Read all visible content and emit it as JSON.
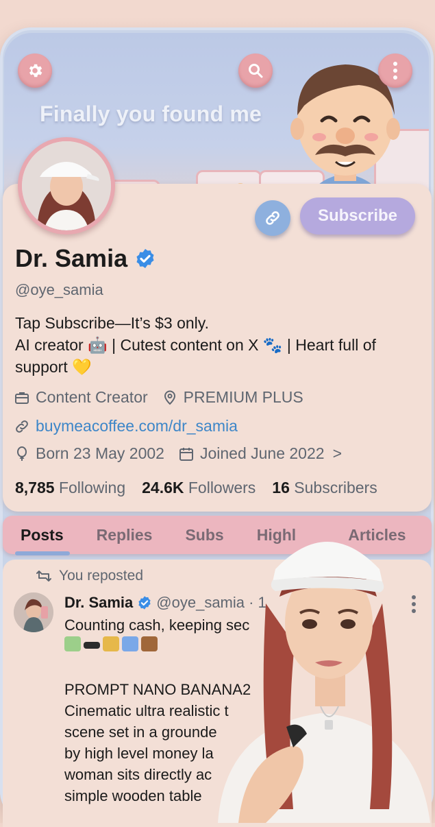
{
  "banner": {
    "title": "Finally you found me"
  },
  "icons": {
    "settings": "gear-icon",
    "search": "search-icon",
    "more": "more-vertical-icon",
    "link": "link-icon",
    "verified": "verified-badge-icon",
    "briefcase": "briefcase-icon",
    "location": "location-icon",
    "url": "link-icon",
    "birthday": "balloon-icon",
    "calendar": "calendar-icon",
    "repost": "repost-icon"
  },
  "profile": {
    "subscribe_label": "Subscribe",
    "name": "Dr. Samia",
    "handle": "@oye_samia",
    "bio": {
      "line1": "Tap Subscribe—It’s $3 only.",
      "line2": "AI creator 🤖 | Cutest content on X 🐾 | Heart full of",
      "line3": "support 💛"
    },
    "category": "Content Creator",
    "location": "PREMIUM PLUS",
    "website": "buymeacoffee.com/dr_samia",
    "born": "Born 23 May 2002",
    "joined": "Joined June 2022",
    "joined_chevron": ">",
    "stats": {
      "following_count": "8,785",
      "following_label": "Following",
      "followers_count": "24.6K",
      "followers_label": "Followers",
      "subscribers_count": "16",
      "subscribers_label": "Subscribers"
    }
  },
  "tabs": {
    "posts": "Posts",
    "replies": "Replies",
    "subs": "Subs",
    "highlights": "Highl",
    "articles": "Articles"
  },
  "post": {
    "repost_label": "You reposted",
    "author": "Dr. Samia",
    "handle": "@oye_samia · 1",
    "line1": "Counting cash, keeping sec",
    "line2": "PROMPT NANO BANANA2",
    "line3": "Cinematic ultra realistic t",
    "line4": "scene set in a grounde",
    "line5": "by high level money la",
    "line6": "woman sits directly ac",
    "line7": "simple wooden table"
  },
  "colors": {
    "accent_blue": "#3d86c8",
    "subscribe_bg": "#b5a9de",
    "tab_bg": "#ecb6bf",
    "verified": "#3a8de6"
  }
}
